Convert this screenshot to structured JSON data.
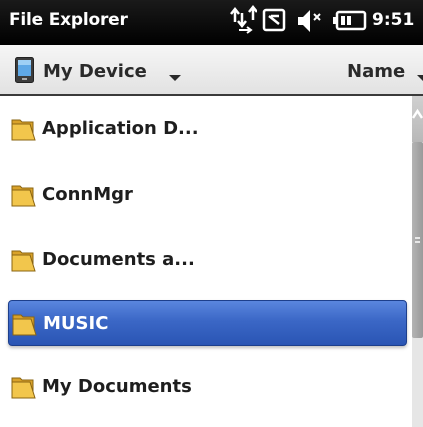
{
  "titlebar": {
    "title": "File Explorer",
    "time": "9:51",
    "icons": [
      "connectivity-icon",
      "phone-missed-icon",
      "volume-icon",
      "battery-icon"
    ]
  },
  "header": {
    "location": "My Device",
    "location_icon": "device-icon",
    "sort": "Name"
  },
  "files": [
    {
      "label": "Application D...",
      "icon": "folder-icon",
      "selected": false
    },
    {
      "label": "ConnMgr",
      "icon": "folder-icon",
      "selected": false
    },
    {
      "label": "Documents a...",
      "icon": "folder-icon",
      "selected": false
    },
    {
      "label": "MUSIC",
      "icon": "folder-icon",
      "selected": true
    },
    {
      "label": "My Documents",
      "icon": "folder-icon",
      "selected": false
    }
  ],
  "colors": {
    "selection": "#3b67c6",
    "titlebar": "#000000",
    "folder": "#e8b93c"
  }
}
